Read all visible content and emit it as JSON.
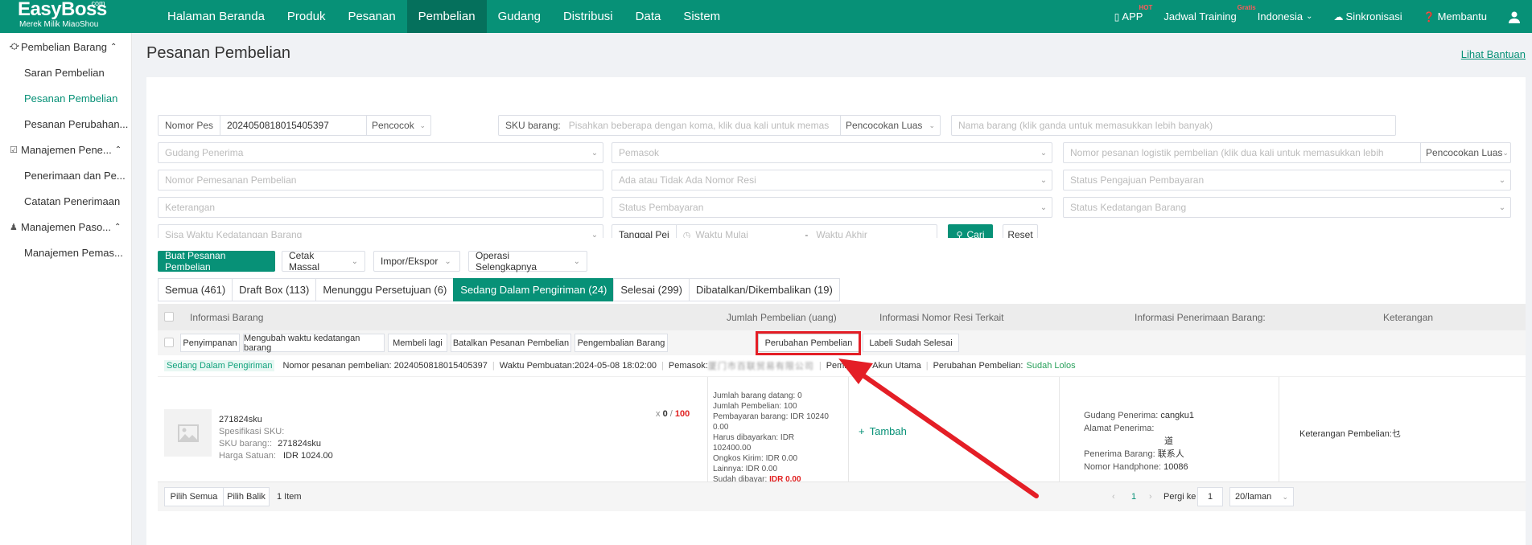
{
  "brand": {
    "name": "EasyBoss",
    "com": ".com",
    "subtitle": "Merek Milik MiaoShou"
  },
  "nav": [
    {
      "label": "Halaman Beranda"
    },
    {
      "label": "Produk"
    },
    {
      "label": "Pesanan"
    },
    {
      "label": "Pembelian",
      "active": true
    },
    {
      "label": "Gudang"
    },
    {
      "label": "Distribusi"
    },
    {
      "label": "Data"
    },
    {
      "label": "Sistem"
    }
  ],
  "top_right": {
    "app": "APP",
    "app_badge": "HOT",
    "training": "Jadwal Training",
    "training_badge": "Gratis",
    "language": "Indonesia",
    "sync": "Sinkronisasi",
    "help": "Membantu"
  },
  "sidebar": {
    "groups": [
      {
        "label": "Pembelian Barang",
        "items": [
          "Saran Pembelian",
          "Pesanan Pembelian",
          "Pesanan Perubahan..."
        ]
      },
      {
        "label": "Manajemen Pene...",
        "items": [
          "Penerimaan dan Pe...",
          "Catatan Penerimaan"
        ]
      },
      {
        "label": "Manajemen Paso...",
        "items": [
          "Manajemen Pemas..."
        ]
      }
    ],
    "active_item": "Pesanan Pembelian"
  },
  "page": {
    "title": "Pesanan Pembelian",
    "help_link": "Lihat Bantuan"
  },
  "filters": {
    "order_no_label": "Nomor Pes",
    "order_no_value": "20240508180154053​97",
    "match_mode": "Pencocok",
    "sku_label": "SKU barang:",
    "sku_placeholder": "Pisahkan beberapa dengan koma, klik dua kali untuk memas",
    "sku_match": "Pencocokan Luas",
    "product_name_placeholder": "Nama barang (klik ganda untuk memasukkan lebih banyak)",
    "warehouse_placeholder": "Gudang Penerima",
    "supplier_placeholder": "Pemasok",
    "logistics_placeholder": "Nomor pesanan logistik pembelian (klik dua kali untuk memasukkan lebih",
    "logistics_match": "Pencocokan Luas",
    "purchase_order_placeholder": "Nomor Pemesanan Pembelian",
    "tracking_placeholder": "Ada atau Tidak Ada Nomor Resi",
    "payment_request_placeholder": "Status Pengajuan Pembayaran",
    "remark_placeholder": "Keterangan",
    "payment_status_placeholder": "Status Pembayaran",
    "arrival_status_placeholder": "Status Kedatangan Barang",
    "remaining_time_placeholder": "Sisa Waktu Kedatangan Barang",
    "date_label": "Tanggal Pei",
    "start_placeholder": "Waktu Mulai",
    "date_sep": "-",
    "end_placeholder": "Waktu Akhir",
    "search_button": "Cari",
    "reset_button": "Reset"
  },
  "toolbar": {
    "create": "Buat Pesanan Pembelian",
    "bulk_print": "Cetak Massal",
    "import_export": "Impor/Ekspor",
    "more_ops": "Operasi Selengkapnya"
  },
  "tabs": [
    {
      "label": "Semua (461)"
    },
    {
      "label": "Draft Box (113)"
    },
    {
      "label": "Menunggu Persetujuan (6)"
    },
    {
      "label": "Sedang Dalam Pengiriman (24)",
      "active": true
    },
    {
      "label": "Selesai (299)"
    },
    {
      "label": "Dibatalkan/Dikembalikan (19)"
    }
  ],
  "table_headers": {
    "product_info": "Informasi Barang",
    "purchase_qty": "Jumlah Pembelian (uang)",
    "tracking_info": "Informasi Nomor Resi Terkait",
    "receiving_info": "Informasi Penerimaan Barang:",
    "remarks": "Keterangan"
  },
  "batch_actions": [
    "Penyimpanan",
    "Mengubah waktu kedatangan barang",
    "Membeli lagi",
    "Batalkan Pesanan Pembelian",
    "Pengembalian Barang",
    "Perubahan Pembelian",
    "Labeli Sudah Selesai"
  ],
  "order": {
    "status_tag": "Sedang Dalam Pengiriman",
    "order_no": "Nomor pesanan pembelian: 20240508180154053​97",
    "created": "Waktu Pembuatan:2024-05-08 18:02:00",
    "supplier_label": "Pemasok:",
    "supplier_value": "厦门市百联贸易有限公司",
    "buyer": "Pembelian: Akun Utama",
    "change_label": "Perubahan Pembelian:",
    "change_value": "Sudah Lolos",
    "product": {
      "name": "271824sku",
      "spec_label": "Spesifikasi SKU:",
      "sku_label": "SKU barang::",
      "sku_value": "271824sku",
      "unit_price_label": "Harga Satuan:",
      "unit_price_value": "IDR 1024.00",
      "qty_prefix": "x",
      "qty_received": "0",
      "qty_sep": "/",
      "qty_total": "100"
    },
    "payment": {
      "arrived": "Jumlah barang datang: 0",
      "purchase_qty": "Jumlah Pembelian: 100",
      "goods_payment": "Pembayaran barang: IDR 102400.00",
      "payable": "Harus dibayarkan: IDR 102400.00",
      "shipping": "Ongkos Kirim: IDR 0.00",
      "other": "Lainnya: IDR 0.00",
      "paid_label": "Sudah dibayar:",
      "paid_value": "IDR 0.00"
    },
    "add_link": "Tambah",
    "receiving": {
      "warehouse_label": "Gudang Penerima:",
      "warehouse_value": "cangku1",
      "address_label": "Alamat Penerima:",
      "address_tail": "道",
      "receiver_label": "Penerima Barang:",
      "receiver_value": "联系人",
      "phone_label": "Nomor Handphone:",
      "phone_value": "10086"
    },
    "remark_label": "Keterangan Pembelian:",
    "remark_value": "乜"
  },
  "footer": {
    "select_all": "Pilih Semua",
    "invert": "Pilih Balik",
    "count": "1 Item",
    "page": "1",
    "goto_label": "Pergi ke",
    "goto_value": "1",
    "page_size": "20/laman"
  },
  "colors": {
    "brand": "#079177",
    "highlight": "#e41e26"
  }
}
